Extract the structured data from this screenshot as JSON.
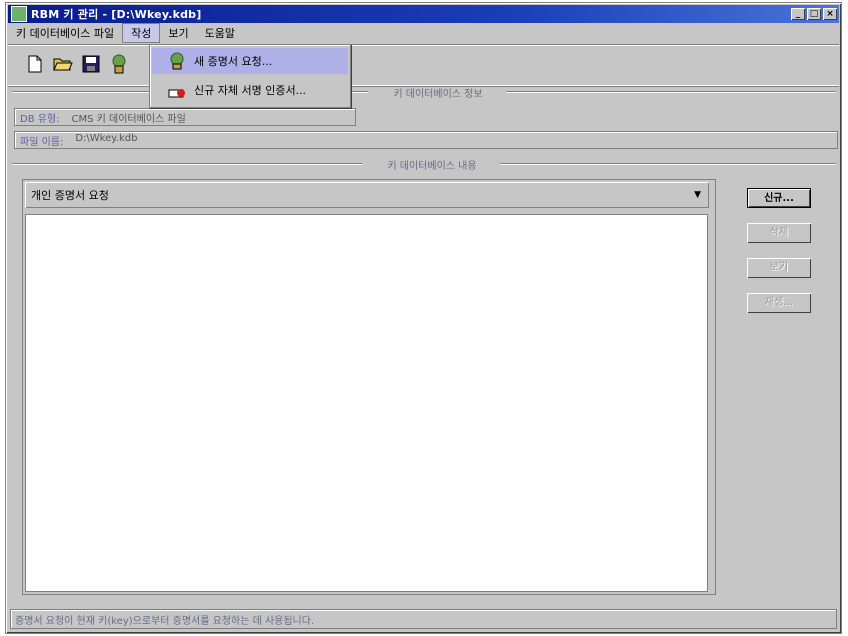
{
  "window": {
    "title": "RBM 키 관리 - [D:\\Wkey.kdb]",
    "controls": [
      "_",
      "□",
      "×"
    ]
  },
  "menubar": {
    "items": [
      "키 데이터베이스 파일",
      "작성",
      "보기",
      "도움말"
    ]
  },
  "dropdown": {
    "items": [
      "새 증명서 요청...",
      "신규 자체 서명 인증서..."
    ]
  },
  "info": {
    "section_title": "키 데이터베이스 정보",
    "db_type_label": "DB 유형:",
    "db_type_value": "CMS 키 데이터베이스 파일",
    "file_name_label": "파일 이름:",
    "file_name_value": "D:\\Wkey.kdb"
  },
  "content": {
    "section_title": "키 데이터베이스 내용",
    "combo_value": "개인 증명서 요청"
  },
  "buttons": {
    "new": "신규...",
    "delete": "삭제",
    "view": "보기",
    "recreate": "재생..."
  },
  "status": {
    "text": "증명서 요청이 현재 키(key)으로부터 증명서를 요청하는 데 사용됩니다."
  }
}
